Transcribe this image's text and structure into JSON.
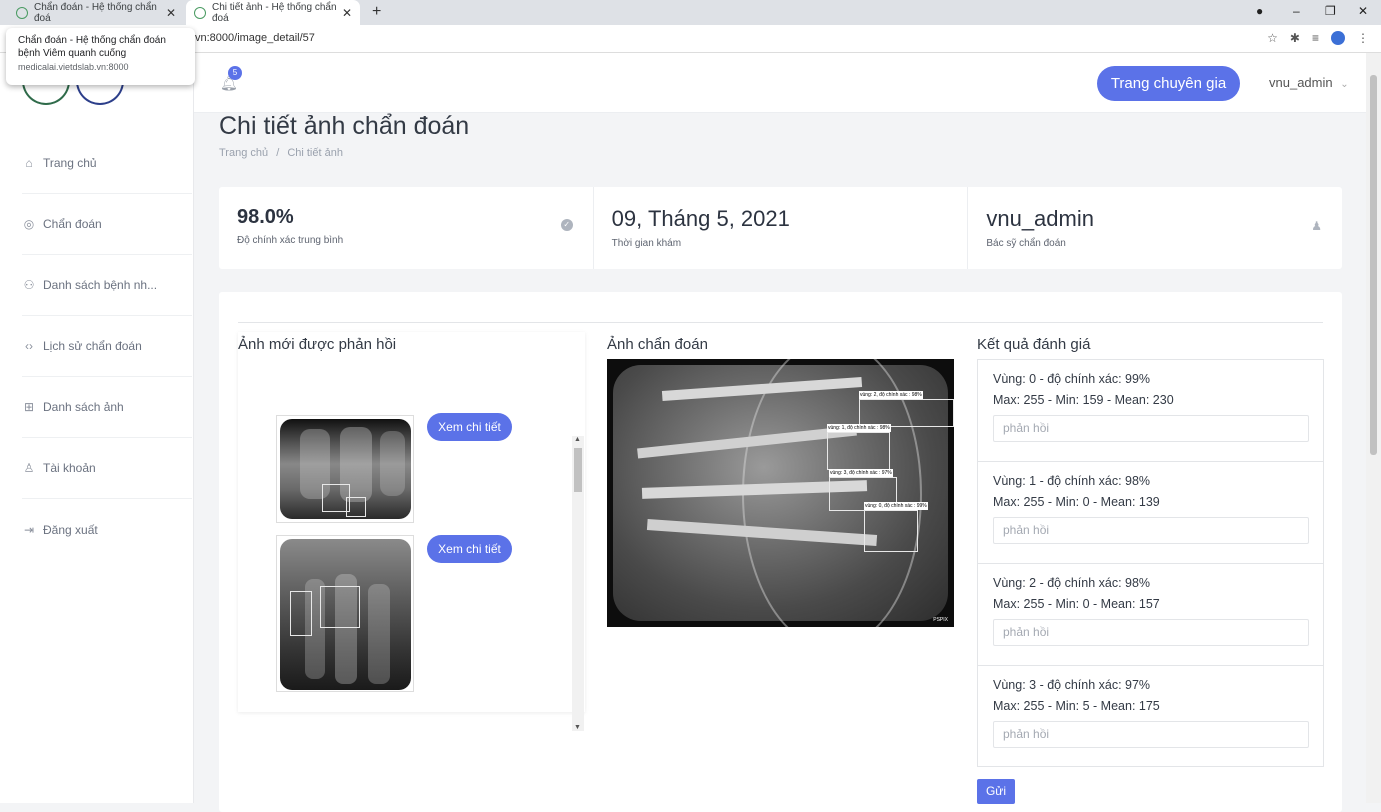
{
  "browser": {
    "tabs": [
      {
        "title": "Chẩn đoán - Hệ thống chẩn đoá",
        "active": false
      },
      {
        "title": "Chi tiết ảnh - Hệ thống chẩn đoá",
        "active": true
      }
    ],
    "url": "vn:8000/image_detail/57",
    "tooltip": {
      "title": "Chẩn đoán - Hệ thống chẩn đoán bệnh Viêm quanh cuống",
      "host": "medicalai.vietdslab.vn:8000"
    }
  },
  "sidebar": {
    "items": [
      {
        "label": "Trang chủ",
        "icon": "home-icon"
      },
      {
        "label": "Chẩn đoán",
        "icon": "target-icon"
      },
      {
        "label": "Danh sách bệnh nh...",
        "icon": "users-icon"
      },
      {
        "label": "Lịch sử chẩn đoán",
        "icon": "code-icon"
      },
      {
        "label": "Danh sách ảnh",
        "icon": "grid-icon"
      },
      {
        "label": "Tài khoản",
        "icon": "user-icon"
      },
      {
        "label": "Đăng xuất",
        "icon": "logout-icon"
      }
    ]
  },
  "header": {
    "notification_count": "5",
    "expert_button": "Trang chuyên gia",
    "username": "vnu_admin"
  },
  "page": {
    "title": "Chi tiết ảnh chẩn đoán",
    "breadcrumb": [
      "Trang chủ",
      "Chi tiết ảnh"
    ]
  },
  "stats": {
    "accuracy": {
      "value": "98.0%",
      "label": "Độ chính xác trung bình"
    },
    "date": {
      "value": "09, Tháng 5, 2021",
      "label": "Thời gian khám"
    },
    "doctor": {
      "value": "vnu_admin",
      "label": "Bác sỹ chẩn đoán"
    }
  },
  "recent": {
    "title": "Ảnh mới được phản hồi",
    "items": [
      {
        "button": "Xem chi tiết"
      },
      {
        "button": "Xem chi tiết"
      }
    ]
  },
  "diagnosis": {
    "title": "Ảnh chẩn đoán",
    "watermark": "PSPIX",
    "boxes": [
      {
        "caption": "vùng: 2, độ chính xác : 98%"
      },
      {
        "caption": "vùng: 1, độ chính xác : 98%"
      },
      {
        "caption": "vùng: 3, độ chính xác : 97%"
      },
      {
        "caption": "vùng: 0, độ chính xác : 99%"
      }
    ]
  },
  "results": {
    "title": "Kết quả đánh giá",
    "regions": [
      {
        "heading": "Vùng: 0 - độ chính xác: 99%",
        "stats": "Max: 255 - Min: 159 - Mean: 230",
        "placeholder": "phản hồi"
      },
      {
        "heading": "Vùng: 1 - độ chính xác: 98%",
        "stats": "Max: 255 - Min: 0 - Mean: 139",
        "placeholder": "phản hồi"
      },
      {
        "heading": "Vùng: 2 - độ chính xác: 98%",
        "stats": "Max: 255 - Min: 0 - Mean: 157",
        "placeholder": "phản hồi"
      },
      {
        "heading": "Vùng: 3 - độ chính xác: 97%",
        "stats": "Max: 255 - Min: 5 - Mean: 175",
        "placeholder": "phản hồi"
      }
    ],
    "submit": "Gửi"
  }
}
